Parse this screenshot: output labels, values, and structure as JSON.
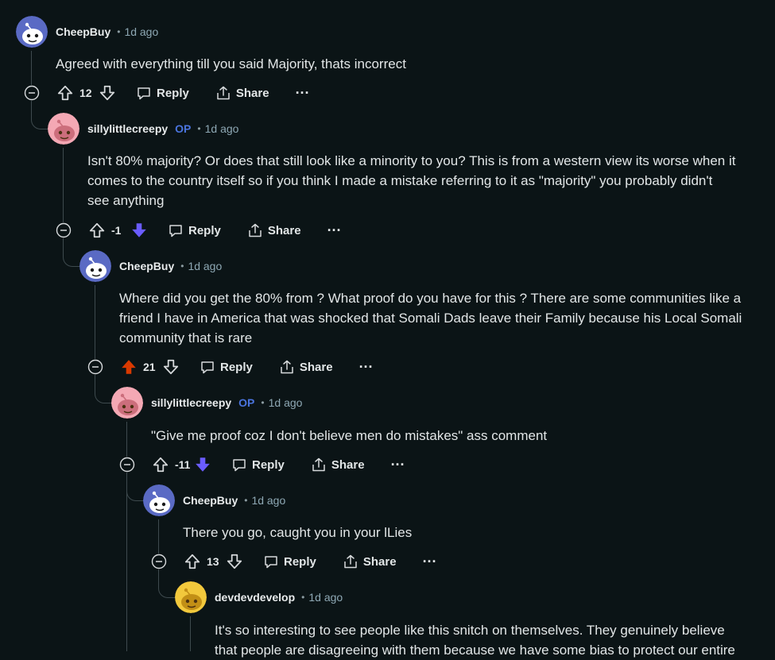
{
  "comments": [
    {
      "author": "CheepBuy",
      "op": false,
      "time": "1d ago",
      "avatar": "snoo-blue-avatar",
      "lines": [
        "Agreed with everything till you said Majority, thats incorrect"
      ],
      "score": "12",
      "vote_state": "none"
    },
    {
      "author": "sillylittlecreepy",
      "op": true,
      "op_label": "OP",
      "time": "1d ago",
      "avatar": "snoo-pink-avatar",
      "lines": [
        "Isn't 80% majority? Or does that still look like a minority to you? This is from a western view its worse when it",
        "comes to the country itself so if you think I made a mistake referring to it as \"majority\" you probably didn't",
        "see anything"
      ],
      "score": "-1",
      "vote_state": "down"
    },
    {
      "author": "CheepBuy",
      "op": false,
      "time": "1d ago",
      "avatar": "snoo-blue-avatar",
      "lines": [
        "Where did you get the 80% from ? What proof do you have for this ? There are some communities like a",
        "friend I have in America that was shocked that Somali Dads leave their Family because his Local Somali",
        "community that is rare"
      ],
      "score": "21",
      "vote_state": "up"
    },
    {
      "author": "sillylittlecreepy",
      "op": true,
      "op_label": "OP",
      "time": "1d ago",
      "avatar": "snoo-pink-avatar",
      "lines": [
        "\"Give me proof coz I don't believe men do mistakes\" ass comment"
      ],
      "score": "-11",
      "vote_state": "down"
    },
    {
      "author": "CheepBuy",
      "op": false,
      "time": "1d ago",
      "avatar": "snoo-blue-avatar",
      "lines": [
        "There you go, caught you in your lLies"
      ],
      "score": "13",
      "vote_state": "none"
    },
    {
      "author": "devdevdevelop",
      "op": false,
      "time": "1d ago",
      "avatar": "snoo-yellow-avatar",
      "lines": [
        "It's so interesting to see people like this snitch on themselves. They genuinely believe",
        "that people are disagreeing with them because we have some bias to protect our entire"
      ],
      "score": null,
      "vote_state": "none"
    }
  ],
  "actions": {
    "reply_label": "Reply",
    "share_label": "Share",
    "more_label": "···"
  },
  "dot": "•",
  "colors": {
    "background": "#0b1416",
    "upvoted": "#d93900",
    "downvoted": "#6a5cff",
    "op": "#4a74dd",
    "timestamp": "#8ea8b4"
  }
}
